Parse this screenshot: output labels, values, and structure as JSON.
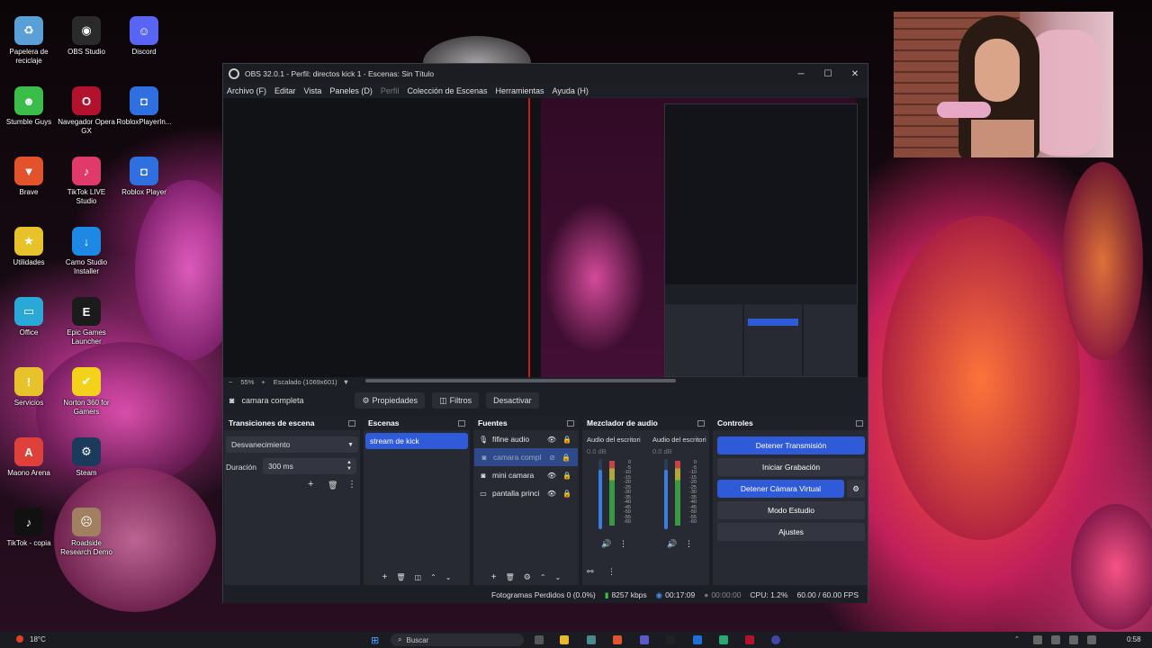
{
  "desktop": {
    "icons": [
      {
        "label": "Papelera de reciclaje",
        "glyph": "♻",
        "color": "#5aa0d8"
      },
      {
        "label": "OBS Studio",
        "glyph": "◉",
        "color": "#2a2a2a"
      },
      {
        "label": "Discord",
        "glyph": "☺",
        "color": "#5865f2"
      },
      {
        "label": "Stumble Guys",
        "glyph": "☻",
        "color": "#3bbd4a"
      },
      {
        "label": "Navegador Opera GX",
        "glyph": "O",
        "color": "#b3122e"
      },
      {
        "label": "RobloxPlayerIn...",
        "glyph": "◘",
        "color": "#2f6fe0"
      },
      {
        "label": "Brave",
        "glyph": "▼",
        "color": "#e2532c"
      },
      {
        "label": "TikTok LIVE Studio",
        "glyph": "♪",
        "color": "#e03a6a"
      },
      {
        "label": "Roblox Player",
        "glyph": "◘",
        "color": "#2f6fe0"
      },
      {
        "label": "Utilidades",
        "glyph": "★",
        "color": "#e8c22a"
      },
      {
        "label": "Camo Studio Installer",
        "glyph": "↓",
        "color": "#1e88e5"
      },
      {
        "label": "Office",
        "glyph": "▭",
        "color": "#2aa8d8"
      },
      {
        "label": "Epic Games Launcher",
        "glyph": "E",
        "color": "#1b1b1b"
      },
      {
        "label": "Servicios",
        "glyph": "!",
        "color": "#e8c22a"
      },
      {
        "label": "Norton 360 for Gamers",
        "glyph": "✔",
        "color": "#f2d21b"
      },
      {
        "label": "Maono Arena",
        "glyph": "A",
        "color": "#e0403a"
      },
      {
        "label": "Steam",
        "glyph": "⚙",
        "color": "#1b3a5c"
      },
      {
        "label": "TikTok - copia",
        "glyph": "♪",
        "color": "#111111"
      },
      {
        "label": "Roadside Research Demo",
        "glyph": "☹",
        "color": "#a08060"
      }
    ]
  },
  "window": {
    "title": "OBS 32.0.1 - Perfil: directos kick 1 - Escenas: Sin Título",
    "min": "─",
    "max": "☐",
    "close": "✕"
  },
  "menu": [
    "Archivo (F)",
    "Editar",
    "Vista",
    "Paneles (D)",
    "Perfil",
    "Colección de Escenas",
    "Herramientas",
    "Ayuda (H)"
  ],
  "preview": {
    "zoom": "55%",
    "scale": "Escalado (1069x601)"
  },
  "source_bar": {
    "selected_source": "camara completa",
    "properties": "Propiedades",
    "filters": "Filtros",
    "deactivate": "Desactivar"
  },
  "transitions": {
    "title": "Transiciones de escena",
    "selected": "Desvanecimiento",
    "duration_label": "Duración",
    "duration_value": "300 ms"
  },
  "scenes": {
    "title": "Escenas",
    "items": [
      "stream de kick"
    ]
  },
  "sources": {
    "title": "Fuentes",
    "items": [
      {
        "name": "fifine audio",
        "icon": "mic-icon"
      },
      {
        "name": "camara compl",
        "icon": "camera-icon"
      },
      {
        "name": "mini camara",
        "icon": "camera-icon"
      },
      {
        "name": "pantalla princi",
        "icon": "monitor-icon"
      }
    ]
  },
  "mixer": {
    "title": "Mezclador de audio",
    "channels": [
      {
        "name": "Audio del escritori",
        "db": "0.0 dB",
        "level": 0.85
      },
      {
        "name": "Audio del escritori",
        "db": "0.0 dB",
        "level": 0.85
      }
    ],
    "ticks": [
      "0",
      "-5",
      "-10",
      "-15",
      "-20",
      "-25",
      "-30",
      "-35",
      "-40",
      "-45",
      "-50",
      "-55",
      "-60"
    ]
  },
  "controls": {
    "title": "Controles",
    "stop_stream": "Detener Transmisión",
    "start_record": "Iniciar Grabación",
    "stop_virtual": "Detener Cámara Virtual",
    "studio_mode": "Modo Estudio",
    "settings": "Ajustes"
  },
  "status": {
    "dropped": "Fotogramas Perdidos 0 (0.0%)",
    "bitrate": "8257 kbps",
    "stream_time": "00:17:09",
    "rec_time": "00:00:00",
    "cpu": "CPU: 1.2%",
    "fps": "60.00 / 60.00 FPS"
  },
  "taskbar": {
    "weather": "18°C",
    "search": "Buscar",
    "time": "0:58"
  },
  "colors": {
    "accent": "#2f5bd8",
    "panel": "#272a33",
    "window": "#1d1f26"
  }
}
